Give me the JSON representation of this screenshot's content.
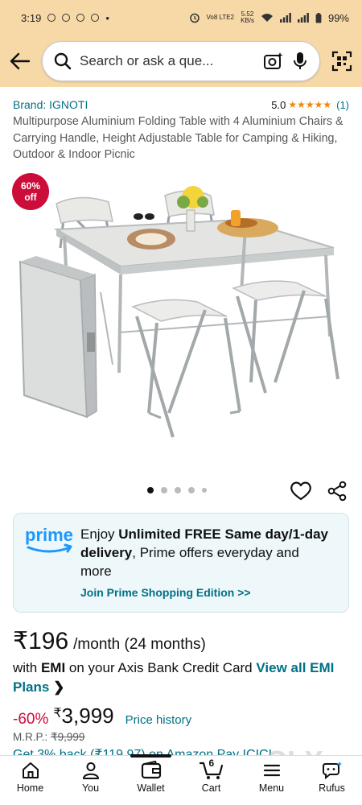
{
  "status_bar": {
    "time": "3:19",
    "network_label": "Vo8 LTE2",
    "speed": "5.52",
    "speed_unit": "KB/s",
    "battery": "99%"
  },
  "search": {
    "placeholder": "Search or ask a que..."
  },
  "product": {
    "brand": "Brand: IGNOTI",
    "rating_value": "5.0",
    "stars": "★★★★★",
    "rating_count": "(1)",
    "title": "Multipurpose Aluminium Folding Table with 4 Aluminium Chairs & Carrying Handle, Height Adjustable Table for Camping & Hiking, Outdoor & Indoor Picnic",
    "discount_badge": {
      "line1": "60%",
      "line2": "off"
    }
  },
  "carousel": {
    "total": 5,
    "active_index": 0
  },
  "prime": {
    "logo_text": "prime",
    "text_intro": "Enjoy ",
    "text_bold_1": "Unlimited FREE Same day/1-day delivery",
    "text_rest": ", Prime offers everyday and more",
    "link": "Join Prime Shopping Edition >>"
  },
  "price": {
    "emi_amount": "₹196",
    "per_month": "/month (24 months)",
    "emi_with": "with ",
    "emi_bold": "EMI",
    "emi_card": " on your Axis Bank Credit Card ",
    "emi_view_all": "View all EMI Plans",
    "discount_pct": "-60%",
    "currency": "₹",
    "sale_price": "3,999",
    "price_history": "Price history",
    "mrp_label": "M.R.P.: ",
    "mrp_value": "₹9,999"
  },
  "cashback_text": "Get 3% back (₹119.97) on Amazon Pay ICICI",
  "nav": {
    "items": [
      {
        "label": "Home",
        "icon": "home-icon"
      },
      {
        "label": "You",
        "icon": "user-icon"
      },
      {
        "label": "Wallet",
        "icon": "wallet-icon"
      },
      {
        "label": "Cart",
        "icon": "cart-icon",
        "count": "6"
      },
      {
        "label": "Menu",
        "icon": "menu-icon"
      },
      {
        "label": "Rufus",
        "icon": "rufus-icon"
      }
    ],
    "active": "Wallet"
  },
  "watermark": "OLX",
  "colors": {
    "header_bg": "#f7d9a8",
    "link": "#007185",
    "star": "#f08804",
    "discount": "#cc0c39",
    "prime_blue": "#1a98ff"
  }
}
